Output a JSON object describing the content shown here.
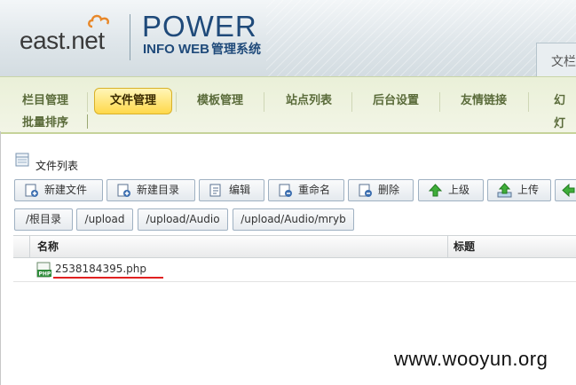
{
  "header": {
    "logo_text": "east.net",
    "brand_power": "POWER",
    "brand_infoweb": "INFO WEB",
    "brand_system": "管理系统",
    "top_right_label": "文栏"
  },
  "nav": {
    "items": [
      {
        "label": "栏目管理"
      },
      {
        "label": "文件管理",
        "active": true
      },
      {
        "label": "模板管理"
      },
      {
        "label": "站点列表"
      },
      {
        "label": "后台设置"
      },
      {
        "label": "友情链接"
      },
      {
        "label": "幻灯"
      },
      {
        "label": "批量排序"
      }
    ]
  },
  "section": {
    "title": "文件列表"
  },
  "toolbar": {
    "buttons": [
      {
        "label": "新建文件",
        "icon": "new-file-icon"
      },
      {
        "label": "新建目录",
        "icon": "new-folder-icon"
      },
      {
        "label": "编辑",
        "icon": "edit-icon"
      },
      {
        "label": "重命名",
        "icon": "rename-icon"
      },
      {
        "label": "删除",
        "icon": "delete-icon"
      },
      {
        "label": "上级",
        "icon": "up-arrow-icon"
      },
      {
        "label": "上传",
        "icon": "upload-icon"
      }
    ]
  },
  "path": {
    "crumbs": [
      {
        "label": "/根目录"
      },
      {
        "label": "/upload"
      },
      {
        "label": "/upload/Audio"
      },
      {
        "label": "/upload/Audio/mryb"
      }
    ]
  },
  "table": {
    "columns": [
      "名称",
      "标题"
    ],
    "rows": [
      {
        "name": "2538184395.php",
        "title": "",
        "icon": "php-file-icon"
      }
    ]
  },
  "watermark": "www.wooyun.org",
  "colors": {
    "brand_blue": "#1f4a7a",
    "nav_active": "#ffd84a",
    "underline_red": "#e02020"
  }
}
